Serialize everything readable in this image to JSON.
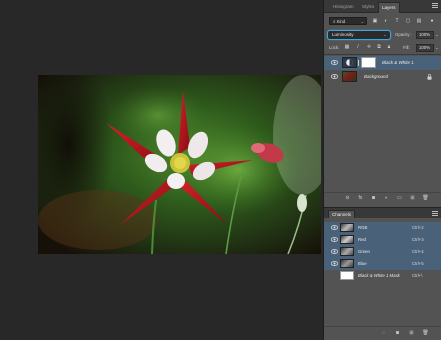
{
  "tabs": [
    {
      "label": "Histogram"
    },
    {
      "label": "Styles"
    },
    {
      "label": "Layers"
    }
  ],
  "filter": {
    "kind_label": "Kind"
  },
  "blend": {
    "mode": "Luminosity",
    "opacity_label": "Opacity:",
    "opacity_value": "100%",
    "fill_label": "Fill:",
    "fill_value": "100%",
    "lock_label": "Lock:"
  },
  "layers": [
    {
      "name": "Black & White 1",
      "selected": true
    },
    {
      "name": "Background",
      "selected": false
    }
  ],
  "channels_tab": {
    "label": "Channels"
  },
  "channels": [
    {
      "name": "RGB",
      "shortcut": "Ctrl+2",
      "selected": true
    },
    {
      "name": "Red",
      "shortcut": "Ctrl+3",
      "selected": true
    },
    {
      "name": "Green",
      "shortcut": "Ctrl+4",
      "selected": true
    },
    {
      "name": "Blue",
      "shortcut": "Ctrl+5",
      "selected": true
    },
    {
      "name": "Black & White 1 Mask",
      "shortcut": "Ctrl+\\",
      "selected": false
    }
  ],
  "colors": {
    "panel_bg": "#535353",
    "canvas_bg": "#282828",
    "selection": "#4a6279",
    "accent": "#3fa7e0",
    "flower_red": "#b0141c"
  },
  "icons": {
    "panel_menu": "hamburger-icon",
    "search": "search-icon",
    "visibility": "eye-icon",
    "lock": "lock-icon"
  }
}
